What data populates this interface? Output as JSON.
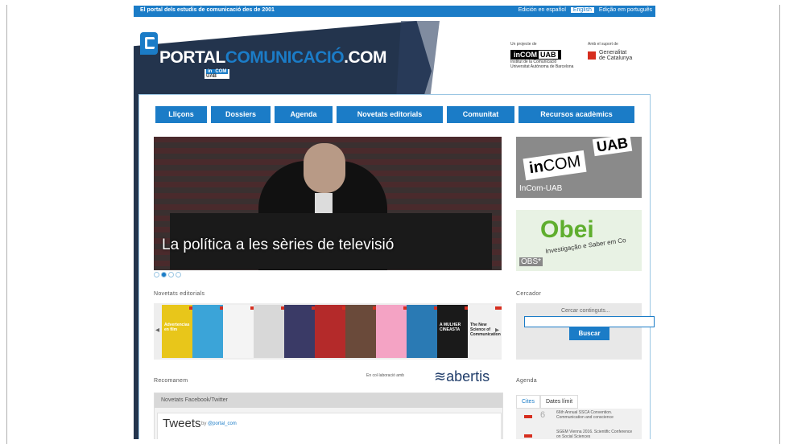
{
  "colors": {
    "accent": "#1b7cc7",
    "navy": "#23344d",
    "red": "#d62e1f"
  },
  "topbar": {
    "tagline": "El portal dels estudis de comunicació des de 2001",
    "langs": [
      "Edición en español",
      "English",
      "Edição em português"
    ]
  },
  "logo": {
    "part1": "PORTAL",
    "part2": "COMUNICACIÓ",
    "part3": ".COM",
    "sub_in": "in",
    "sub_com": "COM",
    "sub_uab": "UAB"
  },
  "partners": {
    "left_head": "Un projecte de",
    "left_badge_in": "in",
    "left_badge_com": "COM",
    "left_badge_uab": "UAB",
    "left_line1": "Institut de la Comunicació",
    "left_line2": "Universitat Autònoma de Barcelona",
    "right_head": "Amb el suport de",
    "right_name1": "Generalitat",
    "right_name2": "de Catalunya"
  },
  "nav": [
    "Lliçons",
    "Dossiers",
    "Agenda",
    "Novetats editorials",
    "Comunitat",
    "Recursos acadèmics"
  ],
  "hero": {
    "caption": "La política a les sèries de televisió"
  },
  "side_banners": [
    {
      "logo_in": "in",
      "logo_com": "COM",
      "logo_uab": "UAB",
      "label": "InCom-UAB"
    },
    {
      "logo": "Obei",
      "tagline": "Investigação e Saber em Co",
      "label": "OBS*"
    }
  ],
  "sections": {
    "novetats": "Novetats editorials",
    "cercador": "Cercador",
    "recomanem": "Recomanem",
    "agenda": "Agenda"
  },
  "books": [
    {
      "title": "Advertencias en film",
      "color": "#e8c61a"
    },
    {
      "title": "",
      "color": "#3ba4d8"
    },
    {
      "title": "",
      "color": "#f4f4f4"
    },
    {
      "title": "",
      "color": "#d8d8d8"
    },
    {
      "title": "",
      "color": "#3a3a66"
    },
    {
      "title": "",
      "color": "#b42a2a"
    },
    {
      "title": "",
      "color": "#6a4a3a"
    },
    {
      "title": "",
      "color": "#f4a3c4"
    },
    {
      "title": "",
      "color": "#2a7ab4"
    },
    {
      "title": "A MULHER CINEASTA",
      "color": "#1a1a1a"
    },
    {
      "title": "The New Science of Communication",
      "color": "#f0f0f0"
    }
  ],
  "search": {
    "placeholder": "Cercar continguts...",
    "button": "Buscar"
  },
  "recommend": {
    "collab_text": "En col·laboració amb",
    "brand": "abertis",
    "panel_header": "Novetats Facebook/Twitter",
    "tweets_title": "Tweets",
    "tweets_by": "by",
    "tweets_handle": "@portal_com"
  },
  "agenda": {
    "tabs": [
      "Cites",
      "Dates límit"
    ],
    "items": [
      {
        "day": "6",
        "text": "66th Annual SSCA Convention. Communication and conscience"
      },
      {
        "day": "",
        "text": "SGEM Vienna 2016. Scientific Conference on Social Sciences"
      }
    ]
  }
}
